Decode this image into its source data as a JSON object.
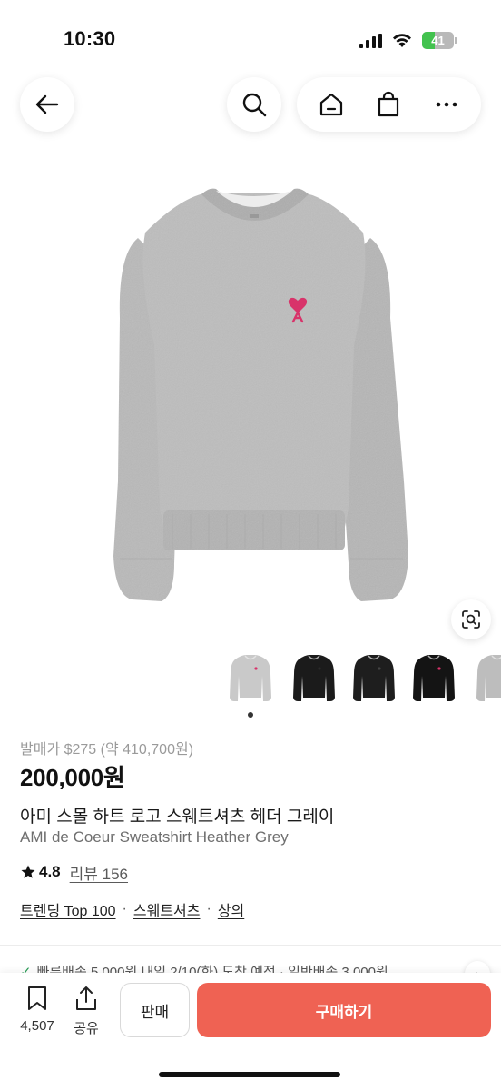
{
  "status": {
    "time": "10:30",
    "battery": "41",
    "battery_level": 0.41
  },
  "nav": {
    "back_icon": "arrow-left-icon",
    "search_icon": "search-icon",
    "home_icon": "home-icon",
    "bag_icon": "shopping-bag-icon",
    "more_icon": "more-horizontal-icon"
  },
  "product": {
    "retail_price": "발매가 $275 (약 410,700원)",
    "price": "200,000원",
    "name_ko": "아미 스몰 하트 로고 스웨트셔츠 헤더 그레이",
    "name_en": "AMI de Coeur Sweatshirt Heather Grey",
    "rating": "4.8",
    "reviews": "리뷰 156",
    "tags": [
      "트렌딩 Top 100",
      "스웨트셔츠",
      "상의"
    ],
    "tag_separator": "·",
    "thumbnails": [
      {
        "color": "#c9c9c9",
        "logo": "#d8336a"
      },
      {
        "color": "#1b1b1b",
        "logo": "#2a2a2a"
      },
      {
        "color": "#1e1e1e",
        "logo": "#444444"
      },
      {
        "color": "#141414",
        "logo": "#d8336a"
      },
      {
        "color": "#bdbdbd",
        "logo": "#9a9a9a"
      }
    ]
  },
  "shipping": {
    "text": "빠른배송 5,000원 내일 2/10(화) 도착 예정 · 일반배송 3,000원"
  },
  "bottom_bar": {
    "bookmark_count": "4,507",
    "share_label": "공유",
    "sell_label": "판매",
    "buy_label": "구매하기"
  },
  "colors": {
    "accent": "#ef6253",
    "sweatshirt": "#bcbcbc",
    "heart_logo": "#d8336a"
  }
}
